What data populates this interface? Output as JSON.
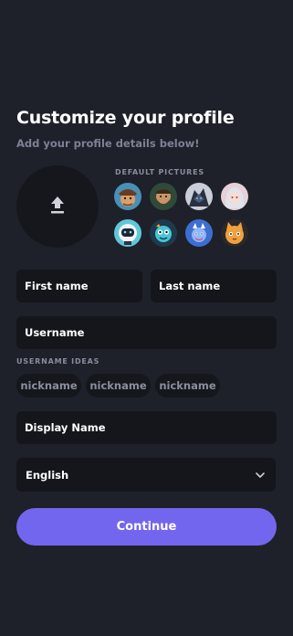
{
  "header": {
    "title": "Customize your profile",
    "subtitle": "Add your profile details below!"
  },
  "upload": {
    "icon": "upload-icon"
  },
  "default_pictures": {
    "label": "DEFAULT PICTURES",
    "avatars": [
      {
        "icon": "pirate-avatar-icon"
      },
      {
        "icon": "bearded-warrior-avatar-icon"
      },
      {
        "icon": "dark-beast-avatar-icon"
      },
      {
        "icon": "silver-hair-avatar-icon"
      },
      {
        "icon": "astronaut-avatar-icon"
      },
      {
        "icon": "fish-character-avatar-icon"
      },
      {
        "icon": "blue-dragon-avatar-icon"
      },
      {
        "icon": "orange-cat-avatar-icon"
      }
    ]
  },
  "form": {
    "first_name": "First name",
    "last_name": "Last name",
    "username": "Username",
    "display_name": "Display Name"
  },
  "username_ideas": {
    "label": "USERNAME IDEAS",
    "chips": [
      "nickname",
      "nickname",
      "nickname"
    ]
  },
  "language": {
    "selected": "English",
    "icon": "chevron-down-icon"
  },
  "continue_label": "Continue",
  "colors": {
    "background": "#1e2129",
    "field": "#14161c",
    "accent": "#7366ee",
    "muted_text": "#7e8193"
  }
}
